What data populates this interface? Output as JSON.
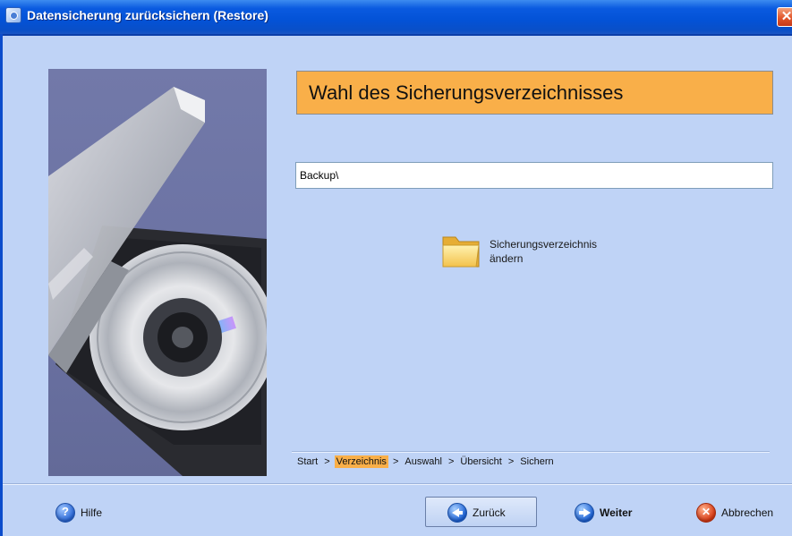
{
  "window": {
    "title": "Datensicherung zurücksichern (Restore)",
    "close_glyph": "✕"
  },
  "header": {
    "title": "Wahl des Sicherungsverzeichnisses",
    "bg_color": "#f9af49"
  },
  "path": {
    "value": "Backup\\"
  },
  "change_folder": {
    "line1": "Sicherungsverzeichnis",
    "line2": "ändern",
    "icon": "folder-icon"
  },
  "breadcrumb": {
    "steps": [
      "Start",
      "Verzeichnis",
      "Auswahl",
      "Übersicht",
      "Sichern"
    ],
    "separator": ">",
    "active": "Verzeichnis"
  },
  "buttons": {
    "help": {
      "label": "Hilfe",
      "icon": "help-icon"
    },
    "back": {
      "label": "Zurück",
      "icon": "arrow-left-icon"
    },
    "next": {
      "label": "Weiter",
      "icon": "arrow-right-icon"
    },
    "cancel": {
      "label": "Abbrechen",
      "icon": "cancel-icon"
    }
  }
}
